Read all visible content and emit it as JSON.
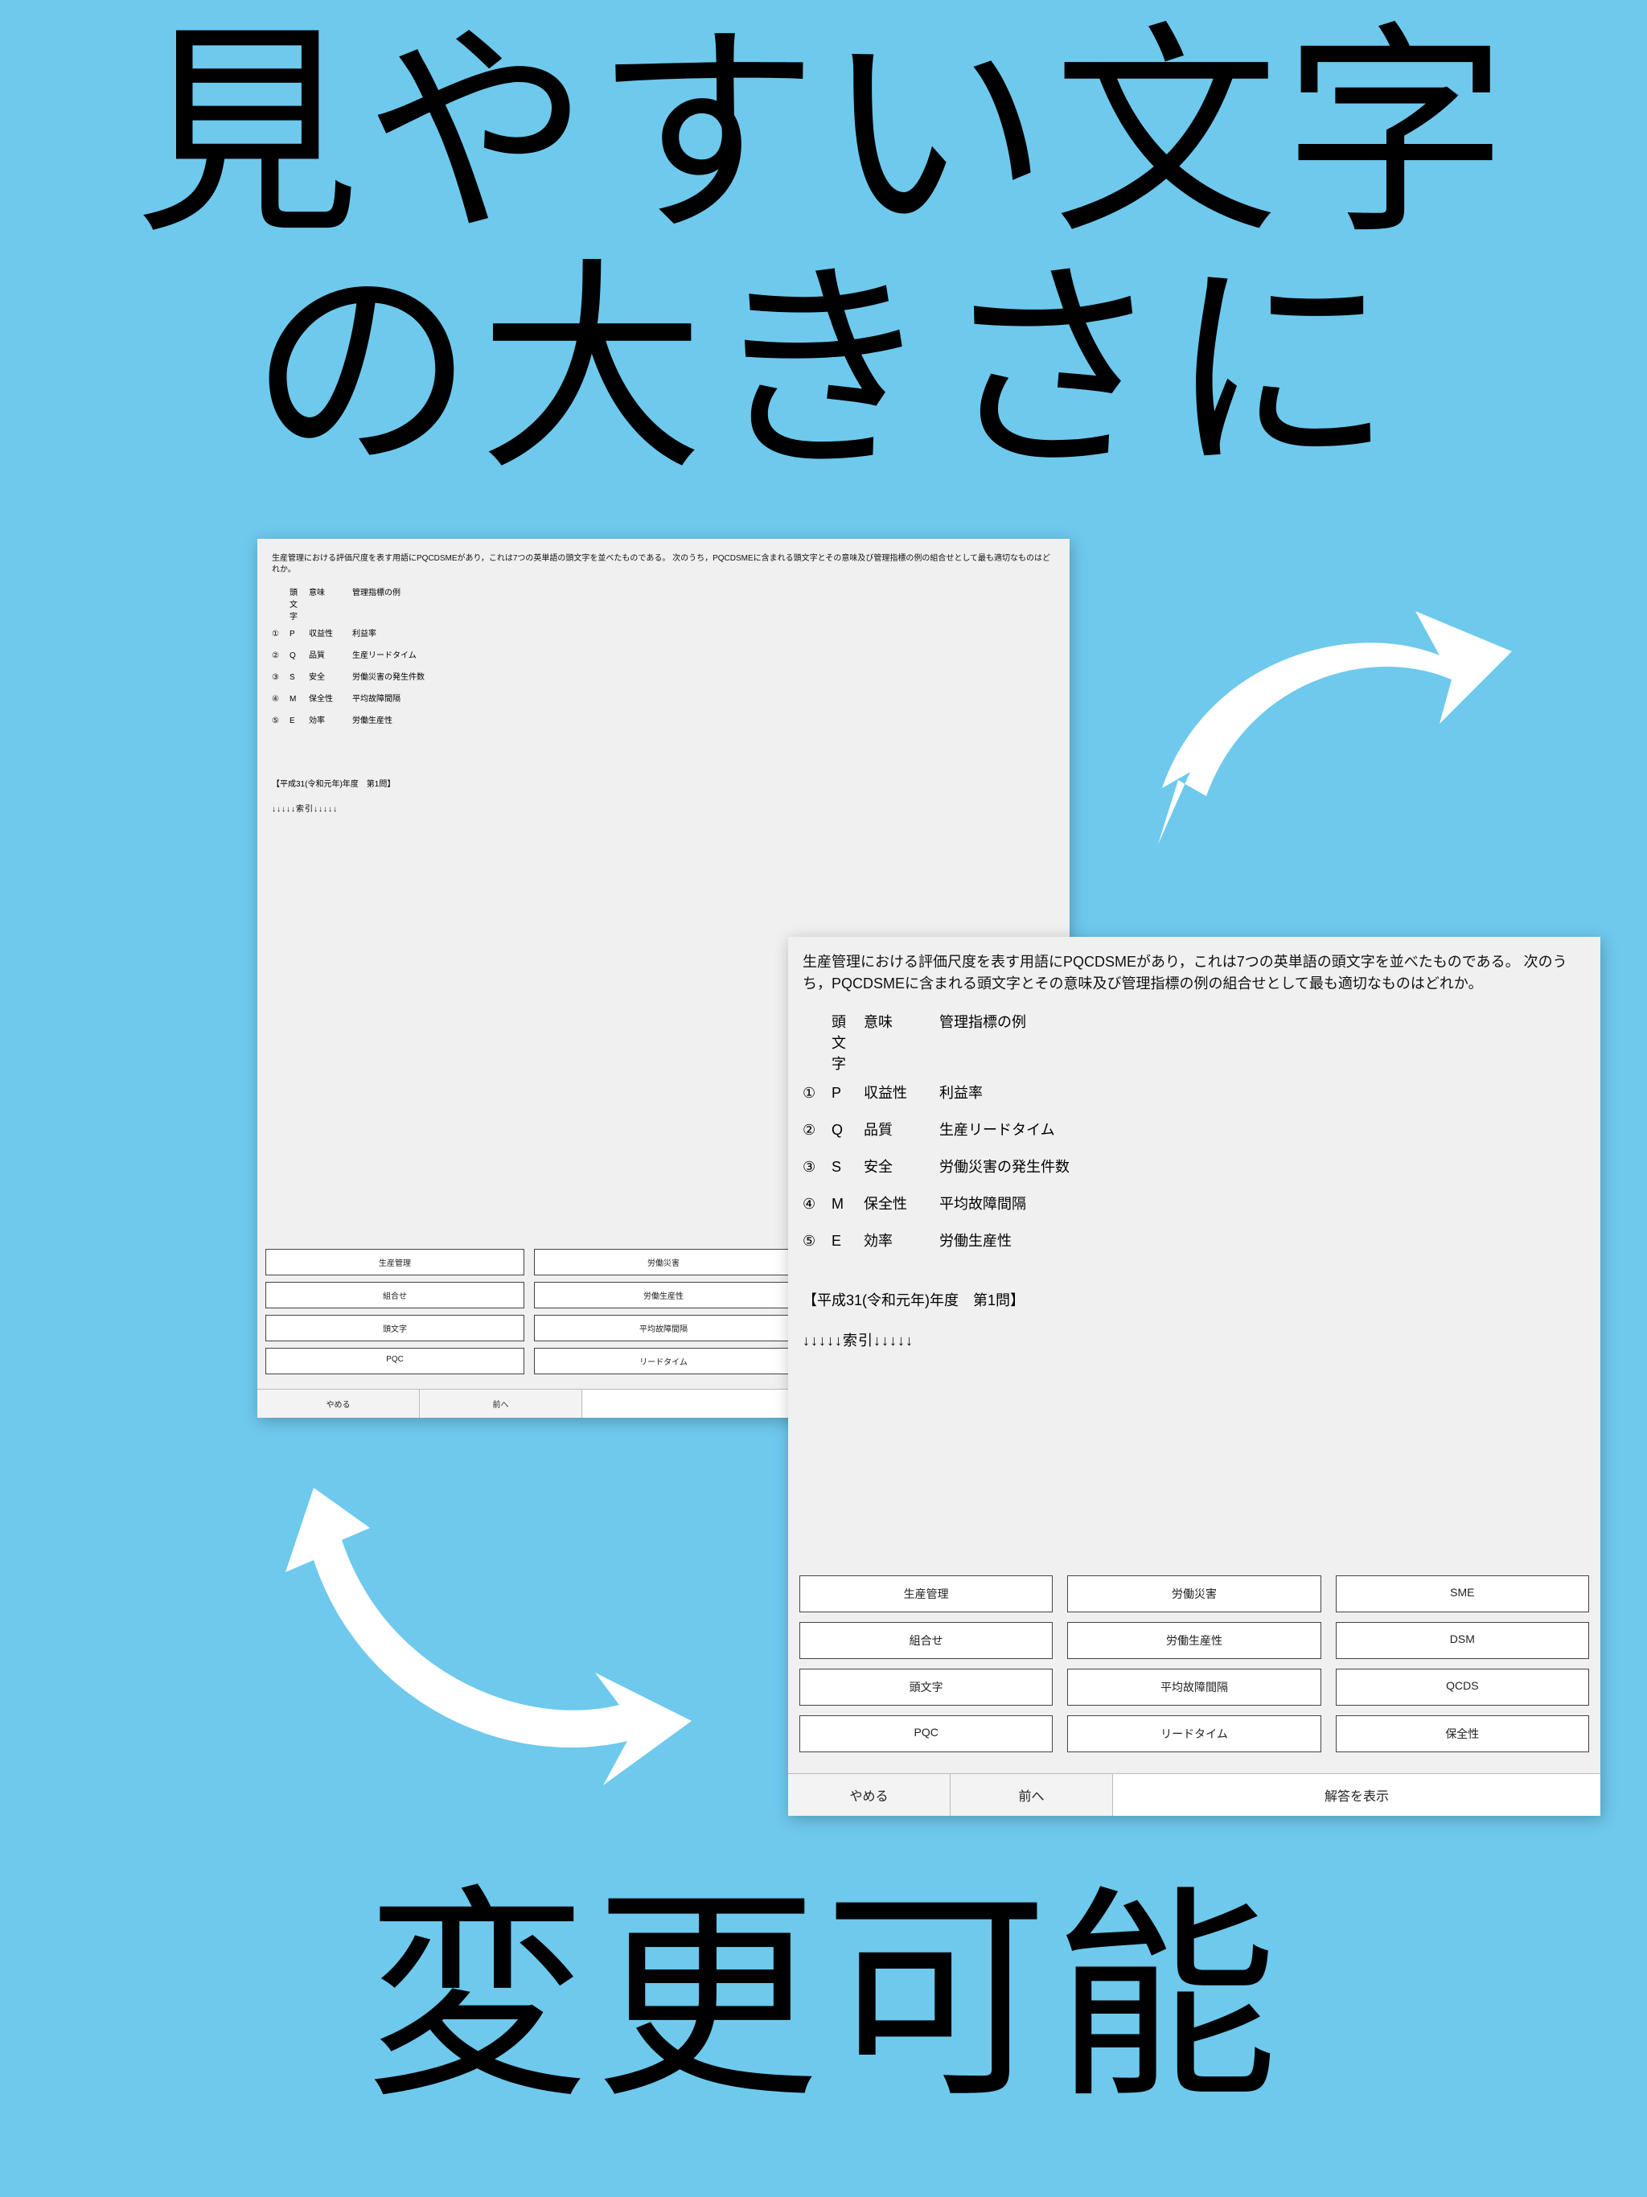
{
  "headline": {
    "top_line1": "見やすい文字",
    "top_line2": "の大きさに",
    "bottom": "変更可能"
  },
  "question": {
    "text": "生産管理における評価尺度を表す用語にPQCDSMEがあり，これは7つの英単語の頭文字を並べたものである。 次のうち，PQCDSMEに含まれる頭文字とその意味及び管理指標の例の組合せとして最も適切なものはどれか。",
    "header": {
      "letter": "頭文字",
      "meaning": "意味",
      "example": "管理指標の例"
    },
    "options": [
      {
        "num": "①",
        "letter": "P",
        "meaning": "収益性",
        "example": "利益率"
      },
      {
        "num": "②",
        "letter": "Q",
        "meaning": "品質",
        "example": "生産リードタイム"
      },
      {
        "num": "③",
        "letter": "S",
        "meaning": "安全",
        "example": "労働災害の発生件数"
      },
      {
        "num": "④",
        "letter": "M",
        "meaning": "保全性",
        "example": "平均故障間隔"
      },
      {
        "num": "⑤",
        "letter": "E",
        "meaning": "効率",
        "example": "労働生産性"
      }
    ],
    "year_label": "【平成31(令和元年)年度　第1問】",
    "index_label": "↓↓↓↓↓索引↓↓↓↓↓"
  },
  "answers": [
    [
      "生産管理",
      "労働災害",
      "SME"
    ],
    [
      "組合せ",
      "労働生産性",
      "DSM"
    ],
    [
      "頭文字",
      "平均故障間隔",
      "QCDS"
    ],
    [
      "PQC",
      "リードタイム",
      "保全性"
    ]
  ],
  "buttons": {
    "quit": "やめる",
    "prev": "前へ",
    "show_answer": "解答を表示"
  }
}
